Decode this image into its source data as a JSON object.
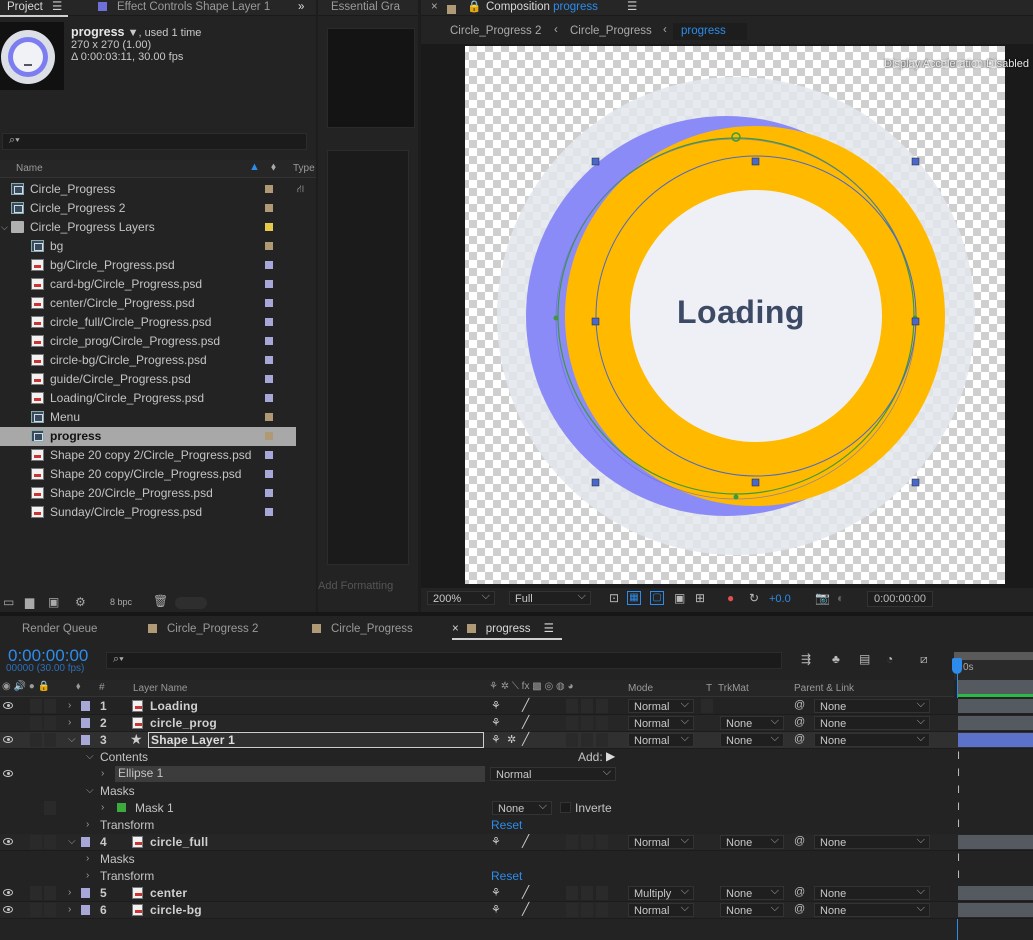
{
  "project": {
    "tab": "Project",
    "effect_tab": "Effect Controls Shape Layer 1",
    "essential_tab": "Essential Gra",
    "comp_name": "progress",
    "used": ", used 1 time",
    "dims": "270 x 270 (1.00)",
    "duration": "Δ 0:00:03:11, 30.00 fps",
    "search_icon": "search-icon",
    "col_name": "Name",
    "col_type": "Type",
    "bpc": "8 bpc",
    "items": [
      {
        "name": "Circle_Progress",
        "kind": "comp",
        "color": "#b09a76",
        "indent": 0
      },
      {
        "name": "Circle_Progress 2",
        "kind": "comp",
        "color": "#b09a76",
        "indent": 0
      },
      {
        "name": "Circle_Progress Layers",
        "kind": "folder",
        "color": "#e6c84c",
        "indent": 0
      },
      {
        "name": "bg",
        "kind": "comp",
        "color": "#b09a76",
        "indent": 1
      },
      {
        "name": "bg/Circle_Progress.psd",
        "kind": "psd",
        "color": "#a8a8d8",
        "indent": 1
      },
      {
        "name": "card-bg/Circle_Progress.psd",
        "kind": "psd",
        "color": "#a8a8d8",
        "indent": 1
      },
      {
        "name": "center/Circle_Progress.psd",
        "kind": "psd",
        "color": "#a8a8d8",
        "indent": 1
      },
      {
        "name": "circle_full/Circle_Progress.psd",
        "kind": "psd",
        "color": "#a8a8d8",
        "indent": 1
      },
      {
        "name": "circle_prog/Circle_Progress.psd",
        "kind": "psd",
        "color": "#a8a8d8",
        "indent": 1
      },
      {
        "name": "circle-bg/Circle_Progress.psd",
        "kind": "psd",
        "color": "#a8a8d8",
        "indent": 1
      },
      {
        "name": "guide/Circle_Progress.psd",
        "kind": "psd",
        "color": "#a8a8d8",
        "indent": 1
      },
      {
        "name": "Loading/Circle_Progress.psd",
        "kind": "psd",
        "color": "#a8a8d8",
        "indent": 1
      },
      {
        "name": "Menu",
        "kind": "comp",
        "color": "#b09a76",
        "indent": 1
      },
      {
        "name": "progress",
        "kind": "comp",
        "color": "#b09a76",
        "indent": 1,
        "selected": true
      },
      {
        "name": "Shape 20 copy 2/Circle_Progress.psd",
        "kind": "psd",
        "color": "#a8a8d8",
        "indent": 1
      },
      {
        "name": "Shape 20 copy/Circle_Progress.psd",
        "kind": "psd",
        "color": "#a8a8d8",
        "indent": 1
      },
      {
        "name": "Shape 20/Circle_Progress.psd",
        "kind": "psd",
        "color": "#a8a8d8",
        "indent": 1
      },
      {
        "name": "Sunday/Circle_Progress.psd",
        "kind": "psd",
        "color": "#a8a8d8",
        "indent": 1
      }
    ]
  },
  "essential": {
    "add_formatting": "Add Formatting"
  },
  "composition": {
    "tab_prefix": "Composition",
    "tab_name": "progress",
    "crumbs": [
      "Circle_Progress 2",
      "Circle_Progress",
      "progress"
    ],
    "accel_note": "Display Acceleration Disabled",
    "center_text": "Loading",
    "zoom": "200%",
    "resolution": "Full",
    "exposure": "+0.0",
    "timecode": "0:00:00:00"
  },
  "timeline": {
    "tabs": [
      "Render Queue",
      "Circle_Progress 2",
      "Circle_Progress",
      "progress"
    ],
    "timecode": "0:00:00:00",
    "frames": "00000 (30.00 fps)",
    "col_layer": "Layer Name",
    "col_mode": "Mode",
    "col_t": "T",
    "col_trkmat": "TrkMat",
    "col_parent": "Parent & Link",
    "ruler": "0s",
    "layers": [
      {
        "num": "1",
        "name": "Loading",
        "mode": "Normal",
        "trkmat": "",
        "parent": "None"
      },
      {
        "num": "2",
        "name": "circle_prog",
        "mode": "Normal",
        "trkmat": "None",
        "parent": "None"
      },
      {
        "num": "3",
        "name": "Shape Layer 1",
        "mode": "Normal",
        "trkmat": "None",
        "parent": "None"
      },
      {
        "num": "4",
        "name": "circle_full",
        "mode": "Normal",
        "trkmat": "None",
        "parent": "None"
      },
      {
        "num": "5",
        "name": "center",
        "mode": "Multiply",
        "trkmat": "None",
        "parent": "None"
      },
      {
        "num": "6",
        "name": "circle-bg",
        "mode": "Normal",
        "trkmat": "None",
        "parent": "None"
      }
    ],
    "props": {
      "contents": "Contents",
      "add": "Add:",
      "ellipse": "Ellipse 1",
      "ellipse_mode": "Normal",
      "masks": "Masks",
      "mask1": "Mask 1",
      "mask_mode": "None",
      "inverted": "Inverte",
      "transform": "Transform",
      "reset": "Reset",
      "masks2": "Masks",
      "transform2": "Transform",
      "reset2": "Reset"
    }
  },
  "colors": {
    "accent": "#2d8ceb",
    "ring_yellow": "#ffba00",
    "ring_purple": "#8b8bf7",
    "selection": "#a8a8a8"
  }
}
